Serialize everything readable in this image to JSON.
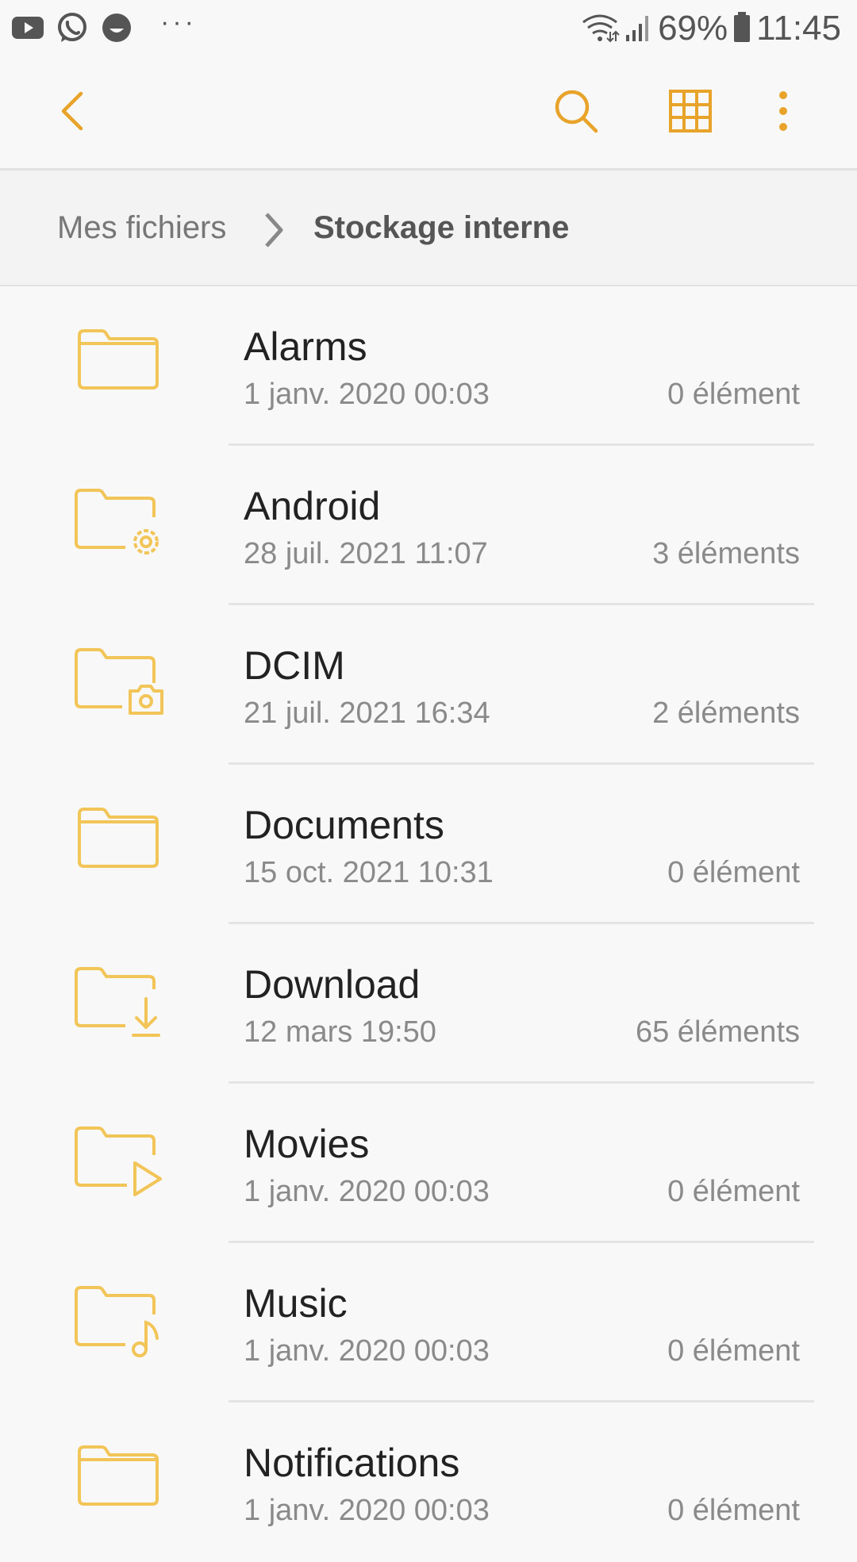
{
  "status_bar": {
    "battery": "69%",
    "time": "11:45",
    "icons": [
      "youtube-icon",
      "whatsapp-icon",
      "smiley-app-icon",
      "more-notifications-icon",
      "wifi-icon",
      "signal-icon",
      "battery-icon"
    ]
  },
  "toolbar": {
    "icons": [
      "back-arrow-icon",
      "search-icon",
      "grid-view-icon",
      "more-options-icon"
    ],
    "accent_color": "#e8a32a"
  },
  "breadcrumb": {
    "root": "Mes fichiers",
    "current": "Stockage interne"
  },
  "folders": [
    {
      "name": "Alarms",
      "date": "1 janv. 2020 00:03",
      "count": "0 élément",
      "icon": "folder-icon"
    },
    {
      "name": "Android",
      "date": "28 juil. 2021 11:07",
      "count": "3 éléments",
      "icon": "folder-settings-icon"
    },
    {
      "name": "DCIM",
      "date": "21 juil. 2021 16:34",
      "count": "2 éléments",
      "icon": "folder-camera-icon"
    },
    {
      "name": "Documents",
      "date": "15 oct. 2021 10:31",
      "count": "0 élément",
      "icon": "folder-icon"
    },
    {
      "name": "Download",
      "date": "12 mars 19:50",
      "count": "65 éléments",
      "icon": "folder-download-icon"
    },
    {
      "name": "Movies",
      "date": "1 janv. 2020 00:03",
      "count": "0 élément",
      "icon": "folder-video-icon"
    },
    {
      "name": "Music",
      "date": "1 janv. 2020 00:03",
      "count": "0 élément",
      "icon": "folder-music-icon"
    },
    {
      "name": "Notifications",
      "date": "1 janv. 2020 00:03",
      "count": "0 élément",
      "icon": "folder-icon"
    }
  ],
  "folder_icon_color": "#f2c558"
}
